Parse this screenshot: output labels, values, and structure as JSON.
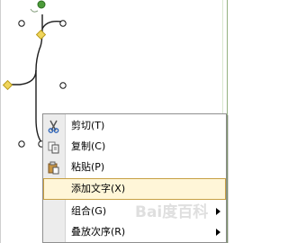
{
  "context_menu": {
    "items": [
      {
        "label": "剪切(T)",
        "icon": "cut-icon"
      },
      {
        "label": "复制(C)",
        "icon": "copy-icon"
      },
      {
        "label": "粘贴(P)",
        "icon": "paste-icon"
      },
      {
        "label": "添加文字(X)",
        "highlighted": true
      },
      {
        "label": "组合(G)",
        "has_submenu": true
      },
      {
        "label": "叠放次序(R)",
        "has_submenu": true
      }
    ]
  },
  "watermark": "Bai度百科",
  "colors": {
    "highlight_fill": "#fff6d8",
    "highlight_border": "#c7a044",
    "handle_green": "#4c9b3a",
    "handle_yellow": "#f0d55b",
    "handle_yellow_border": "#b89b1b"
  }
}
